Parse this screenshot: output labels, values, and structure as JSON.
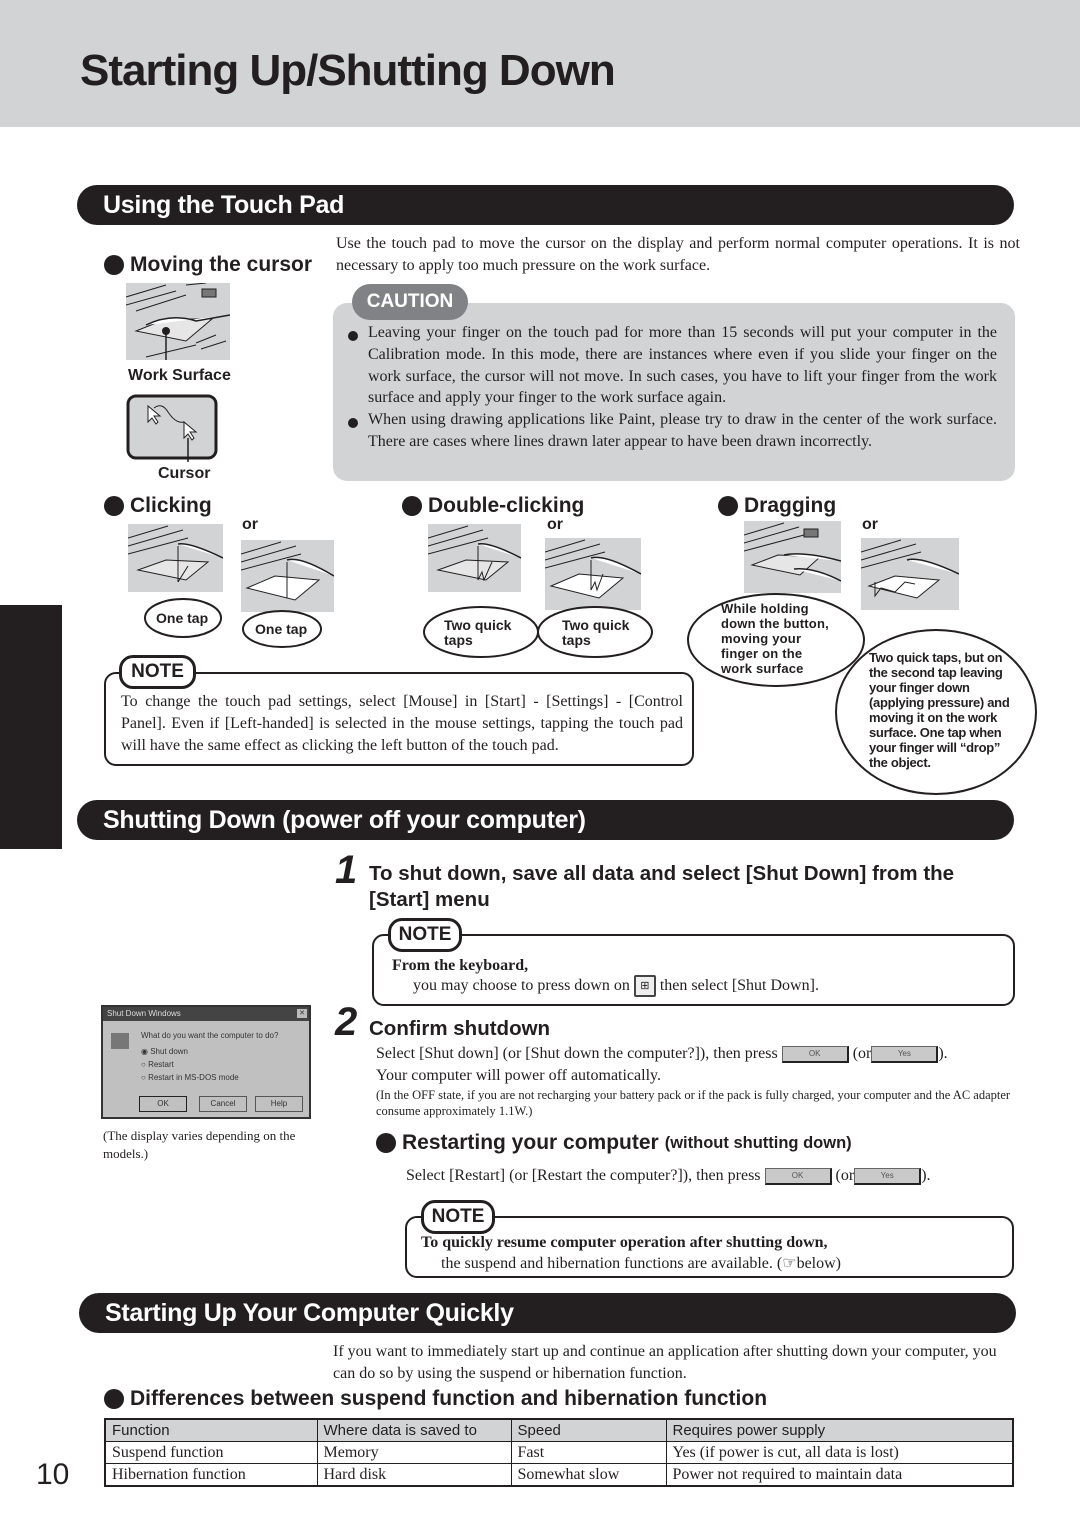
{
  "page": {
    "title": "Starting Up/Shutting Down",
    "page_number": "10"
  },
  "touchpad": {
    "section_title": "Using the Touch Pad",
    "moving": {
      "heading": "Moving the cursor",
      "work_surface_label": "Work Surface",
      "cursor_label": "Cursor"
    },
    "intro": "Use the touch pad to move the cursor on the display and perform normal computer operations.  It is not necessary to apply too much pressure on the work surface.",
    "caution": {
      "tag": "CAUTION",
      "items": [
        "Leaving your finger on the touch pad for more than 15 seconds will put your computer in the Calibration mode. In this mode, there are instances where even if you slide your finger on the work surface, the cursor will not move.  In such cases, you have to lift your finger from the work surface and apply your finger to the work surface again.",
        "When using drawing applications like Paint, please try to draw in the center of the work surface.  There are cases where lines drawn later appear to have been drawn incorrectly."
      ]
    },
    "clicking": {
      "heading": "Clicking",
      "or": "or",
      "bubble1": "One tap",
      "bubble2": "One tap"
    },
    "double_clicking": {
      "heading": "Double-clicking",
      "or": "or",
      "bubble1": "Two quick taps",
      "bubble2": "Two quick taps"
    },
    "dragging": {
      "heading": "Dragging",
      "or": "or",
      "bubble1": "While holding down the button, moving your finger on the work surface",
      "bubble2": "Two quick taps, but on the second tap leaving your finger down (applying pressure) and moving it on the work surface. One tap when your finger will “drop” the object."
    },
    "note": {
      "tag": "NOTE",
      "text": "To change the touch pad settings, select [Mouse] in [Start] - [Settings] - [Control Panel]. Even if [Left-handed] is selected in the mouse settings, tapping the touch pad will have the same effect as clicking the left button of the touch pad."
    }
  },
  "shutdown": {
    "section_title": "Shutting Down (power off your computer)",
    "step1": {
      "number": "1",
      "title": "To shut down, save all data and select [Shut Down] from the [Start] menu",
      "note_tag": "NOTE",
      "note_bold": "From the keyboard,",
      "note_before": "you may choose to press down on",
      "note_key_icon": "windows-key",
      "note_after": "then select [Shut Down]."
    },
    "dialog": {
      "title": "Shut Down Windows",
      "question": "What do you want the computer to do?",
      "options": [
        "Shut down",
        "Restart",
        "Restart in MS-DOS mode"
      ],
      "selected": "Shut down",
      "buttons": [
        "OK",
        "Cancel",
        "Help"
      ],
      "caption": "(The display varies depending on the models.)"
    },
    "step2": {
      "number": "2",
      "title": "Confirm shutdown",
      "line1_before": "Select [Shut down] (or [Shut down the computer?]), then press",
      "ok_label": "OK",
      "or_text": "(or",
      "yes_label": "Yes",
      "close": ").",
      "line2": "Your computer will power off automatically.",
      "small_note": "(In the OFF state, if you are not recharging your battery pack or if the pack is fully charged, your computer and the AC adapter consume approximately 1.1W.)"
    },
    "restart": {
      "heading": "Restarting your computer",
      "heading_suffix": "(without shutting down)",
      "line_before": "Select  [Restart] (or [Restart the computer?]), then press",
      "ok_label": "OK",
      "or_text": "(or",
      "yes_label": "Yes",
      "close": ")."
    },
    "note2": {
      "tag": "NOTE",
      "bold": "To quickly resume computer operation after shutting down,",
      "text_before": "the suspend and hibernation functions are available. (",
      "ref_icon": "pointing-hand",
      "text_after": "below)"
    }
  },
  "quick": {
    "section_title": "Starting Up Your Computer Quickly",
    "intro": "If you want to immediately start up and continue an application after shutting down your computer, you can do so by using the suspend or hibernation function.",
    "diff_heading": "Differences between suspend function and hibernation function",
    "table": {
      "headers": [
        "Function",
        "Where data is saved to",
        "Speed",
        "Requires power supply"
      ],
      "rows": [
        [
          "Suspend function",
          "Memory",
          "Fast",
          "Yes (if power is cut, all data is lost)"
        ],
        [
          "Hibernation function",
          "Hard disk",
          "Somewhat slow",
          "Power not required to maintain data"
        ]
      ]
    }
  }
}
